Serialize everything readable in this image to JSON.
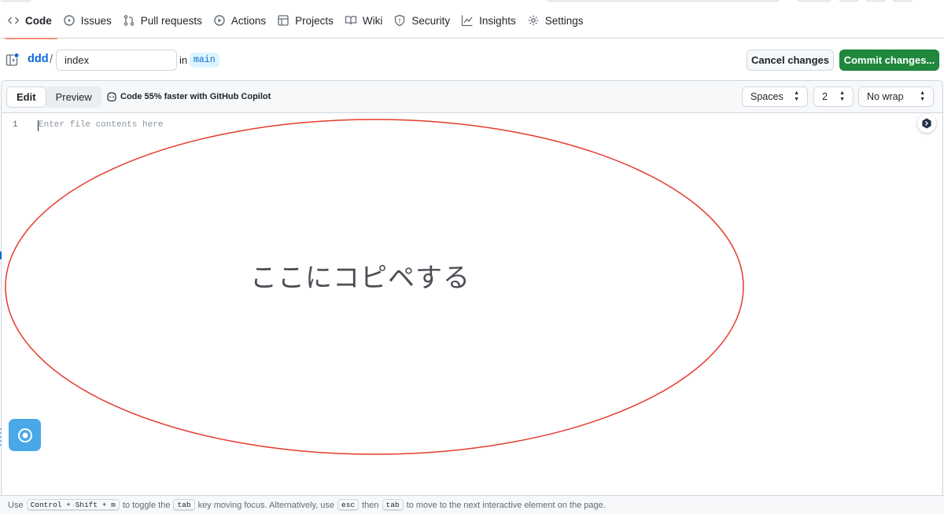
{
  "nav": {
    "items": [
      {
        "label": "Code",
        "icon": "code-icon",
        "active": true
      },
      {
        "label": "Issues",
        "icon": "issue-icon"
      },
      {
        "label": "Pull requests",
        "icon": "pull-request-icon"
      },
      {
        "label": "Actions",
        "icon": "play-icon"
      },
      {
        "label": "Projects",
        "icon": "table-icon"
      },
      {
        "label": "Wiki",
        "icon": "book-icon"
      },
      {
        "label": "Security",
        "icon": "shield-icon"
      },
      {
        "label": "Insights",
        "icon": "graph-icon"
      },
      {
        "label": "Settings",
        "icon": "gear-icon"
      }
    ]
  },
  "breadcrumb": {
    "repo": "ddd",
    "separator": "/",
    "filename_value": "index",
    "in_label": "in",
    "branch": "main"
  },
  "actions": {
    "cancel_label": "Cancel changes",
    "commit_label": "Commit changes..."
  },
  "editor": {
    "tab_edit": "Edit",
    "tab_preview": "Preview",
    "copilot_text": "Code 55% faster with GitHub Copilot",
    "indent_mode": "Spaces",
    "indent_size": "2",
    "wrap_mode": "No wrap",
    "line_number": "1",
    "placeholder": "Enter file contents here"
  },
  "annotation": {
    "text": "ここにコピペする",
    "color": "#e53b2c"
  },
  "footer": {
    "t1": "Use",
    "k1": "Control + Shift + m",
    "t2": "to toggle the",
    "k2": "tab",
    "t3": "key moving focus. Alternatively, use",
    "k3": "esc",
    "t4": "then",
    "k4": "tab",
    "t5": "to move to the next interactive element on the page."
  },
  "colors": {
    "accent": "#0969da",
    "commit_green": "#1f883d",
    "underline": "#fd8c73"
  }
}
